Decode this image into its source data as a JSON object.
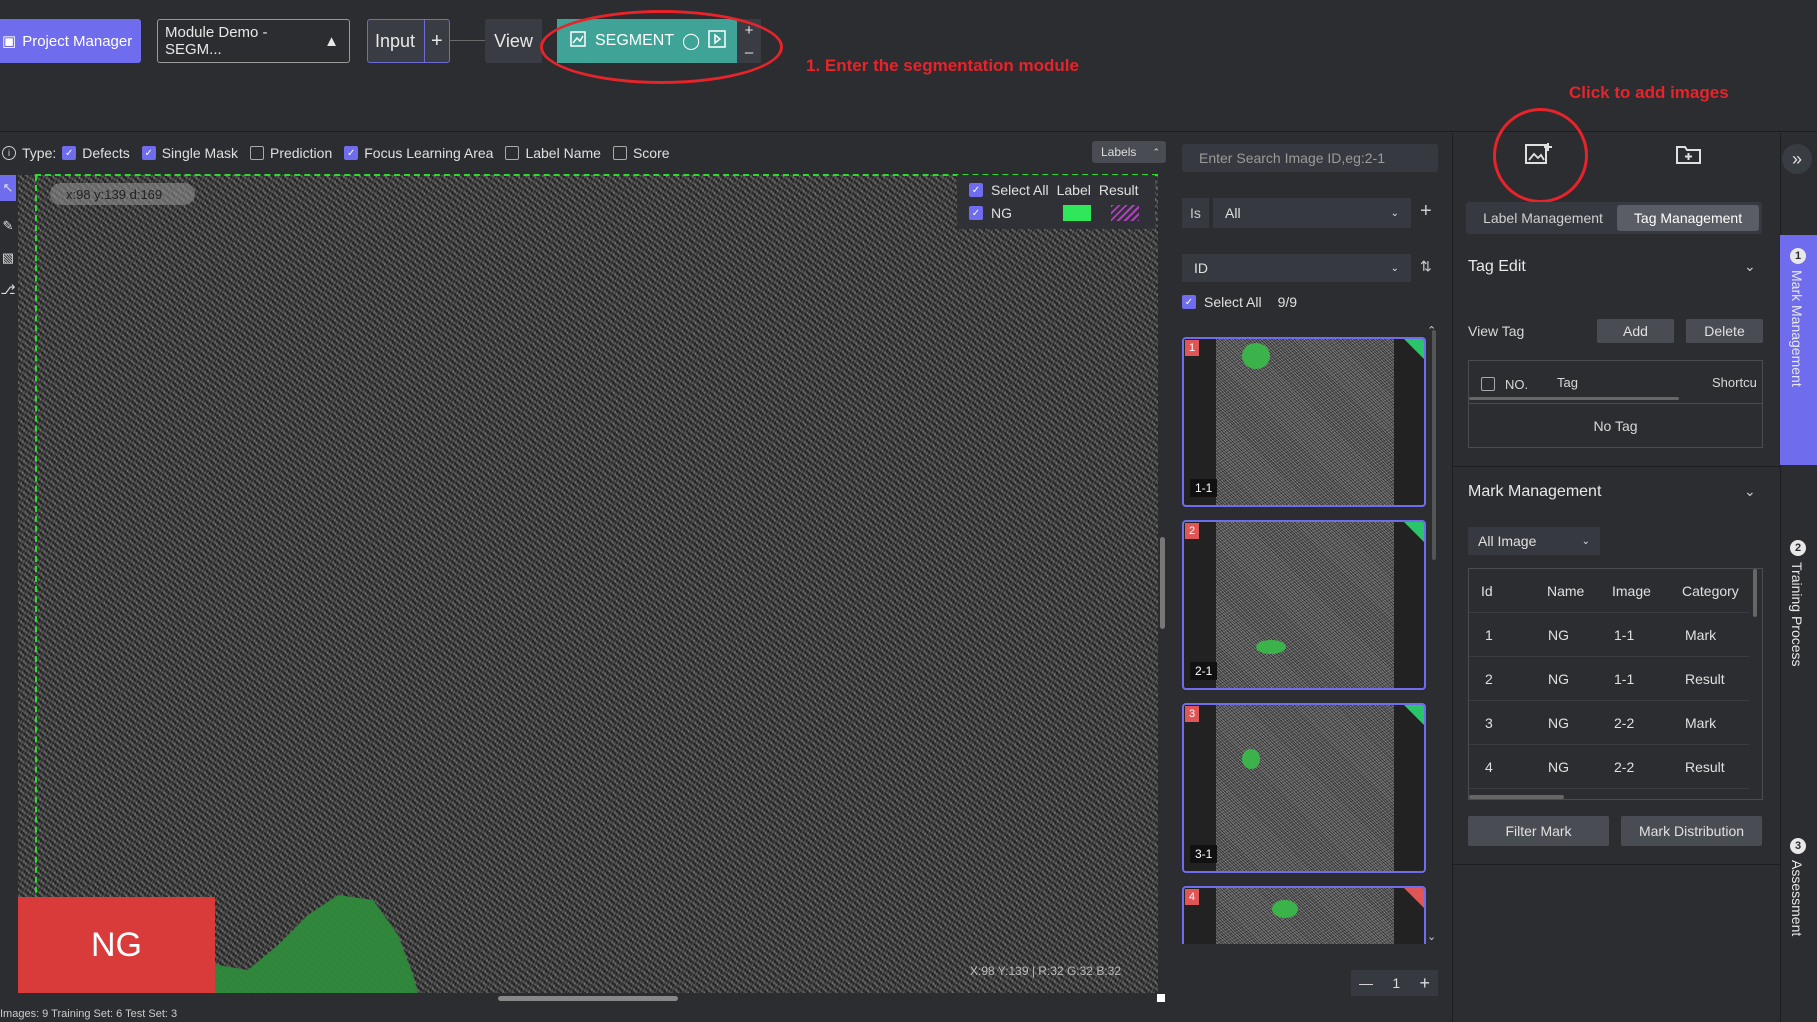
{
  "topbar": {
    "project_manager": "Project Manager",
    "module_select": "Module Demo - SEGM...",
    "node_input": "Input",
    "node_view": "View",
    "node_segment": "SEGMENT"
  },
  "annotations": {
    "step1": "1. Enter the segmentation module",
    "add_images": "Click to add images"
  },
  "typebar": {
    "type_label": "Type:",
    "options": [
      {
        "label": "Defects",
        "checked": true
      },
      {
        "label": "Single Mask",
        "checked": true
      },
      {
        "label": "Prediction",
        "checked": false
      },
      {
        "label": "Focus Learning Area",
        "checked": true
      },
      {
        "label": "Label Name",
        "checked": false
      },
      {
        "label": "Score",
        "checked": false
      }
    ],
    "labels_button": "Labels"
  },
  "canvas": {
    "cursor_readout": "x:98 y:139 d:169",
    "pixel_info": "X:98 Y:139 | R:32 G:32 B:32",
    "ng_badge": "NG",
    "legend": {
      "select_all": "Select All",
      "label_col": "Label",
      "result_col": "Result",
      "class_name": "NG",
      "label_color": "#2ee85a",
      "result_color": "#b040c0"
    }
  },
  "statusbar": {
    "text": "Images: 9    Training Set: 6    Test Set: 3"
  },
  "image_list": {
    "search_placeholder": "Enter Search Image ID,eg:2-1",
    "filter_op": "Is",
    "filter_value": "All",
    "sort_field": "ID",
    "select_all": "Select All",
    "count": "9/9",
    "thumbs": [
      {
        "num": "1",
        "tag": "1-1",
        "status": "ok"
      },
      {
        "num": "2",
        "tag": "2-1",
        "status": "ok"
      },
      {
        "num": "3",
        "tag": "3-1",
        "status": "ok"
      },
      {
        "num": "4",
        "tag": "",
        "status": "ng"
      }
    ],
    "page": "1"
  },
  "right_panel": {
    "tabs": [
      "Label Management",
      "Tag Management"
    ],
    "active_tab": "Tag Management",
    "tag_edit": {
      "title": "Tag Edit",
      "view_tag": "View Tag",
      "add": "Add",
      "delete": "Delete",
      "col_no": "NO.",
      "col_tag": "Tag",
      "col_shortcut": "Shortcu",
      "empty": "No Tag"
    },
    "mark_management": {
      "title": "Mark Management",
      "filter": "All Image",
      "columns": [
        "Id",
        "Name",
        "Image",
        "Category"
      ],
      "rows": [
        [
          "1",
          "NG",
          "1-1",
          "Mark"
        ],
        [
          "2",
          "NG",
          "1-1",
          "Result"
        ],
        [
          "3",
          "NG",
          "2-2",
          "Mark"
        ],
        [
          "4",
          "NG",
          "2-2",
          "Result"
        ]
      ],
      "filter_mark": "Filter Mark",
      "mark_distribution": "Mark Distribution"
    }
  },
  "rail": {
    "items": [
      {
        "num": "1",
        "label": "Mark Management"
      },
      {
        "num": "2",
        "label": "Training Process"
      },
      {
        "num": "3",
        "label": "Assessment"
      }
    ]
  }
}
